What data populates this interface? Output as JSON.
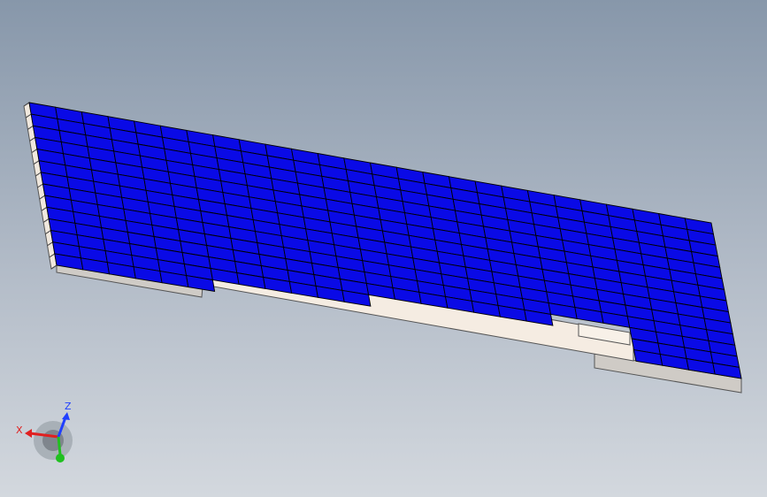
{
  "viewport": {
    "background_top": "#8797aa",
    "background_bottom": "#d3d8de"
  },
  "model": {
    "panel_color": "#0a0ae6",
    "grid_line_color": "#000000",
    "cell_rows": 14,
    "cell_cols": 26,
    "frame_color": "#f5ece2",
    "foot_color": "#cfcbc6"
  },
  "triad": {
    "x_label": "X",
    "z_label": "Z",
    "x_color": "#e02020",
    "y_color": "#20c020",
    "z_color": "#2040ff",
    "y_icon": "y-axis-arrow-icon"
  }
}
